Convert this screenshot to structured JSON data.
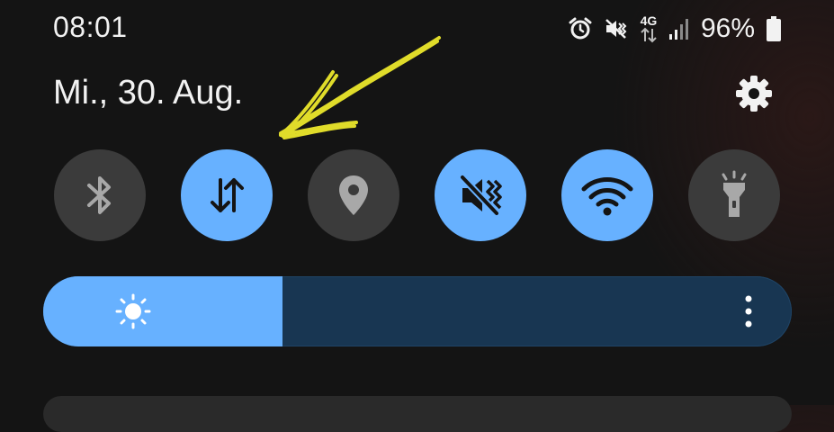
{
  "status_bar": {
    "time": "08:01",
    "icons": [
      "alarm-icon",
      "mute-icon",
      "network-4g-icon",
      "signal-icon"
    ],
    "network_label": "4G",
    "battery_percent": "96%"
  },
  "date": "Mi., 30. Aug.",
  "quick_tiles": [
    {
      "name": "bluetooth",
      "icon": "bluetooth-icon",
      "state": "off"
    },
    {
      "name": "mobile-data",
      "icon": "mobile-data-arrows-icon",
      "state": "on"
    },
    {
      "name": "location",
      "icon": "location-pin-icon",
      "state": "off"
    },
    {
      "name": "vibrate",
      "icon": "vibrate-mute-icon",
      "state": "on"
    },
    {
      "name": "wifi",
      "icon": "wifi-icon",
      "state": "on"
    },
    {
      "name": "flashlight",
      "icon": "flashlight-icon",
      "state": "off"
    }
  ],
  "brightness": {
    "level": 0.32
  },
  "colors": {
    "accent": "#67b1ff",
    "tile_off": "#3b3b3b",
    "background": "#141414",
    "slider_track": "#183652",
    "annotation": "#e0dc2a"
  }
}
